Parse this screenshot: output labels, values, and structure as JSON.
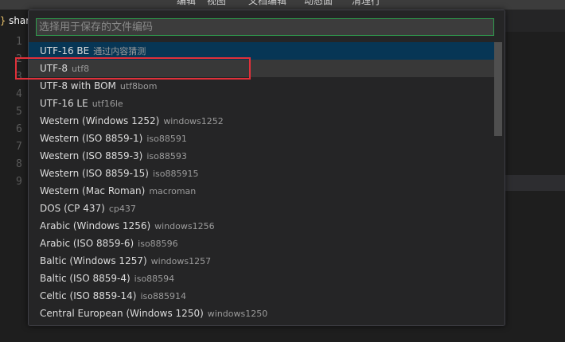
{
  "menubar": {
    "items": [
      "编辑",
      "视图",
      "文档编辑",
      "动态面",
      "清理行"
    ]
  },
  "tab": {
    "icon": "braces-file-icon",
    "label": "shar"
  },
  "gutter": {
    "lines": [
      "1",
      "2",
      "3",
      "4",
      "5",
      "6",
      "7",
      "8",
      "9"
    ]
  },
  "quickpick": {
    "placeholder": "选择用于保存的文件编码",
    "value": "",
    "items": [
      {
        "label": "UTF-16 BE",
        "desc": "通过内容猜测"
      },
      {
        "label": "UTF-8",
        "desc": "utf8"
      },
      {
        "label": "UTF-8 with BOM",
        "desc": "utf8bom"
      },
      {
        "label": "UTF-16 LE",
        "desc": "utf16le"
      },
      {
        "label": "Western (Windows 1252)",
        "desc": "windows1252"
      },
      {
        "label": "Western (ISO 8859-1)",
        "desc": "iso88591"
      },
      {
        "label": "Western (ISO 8859-3)",
        "desc": "iso88593"
      },
      {
        "label": "Western (ISO 8859-15)",
        "desc": "iso885915"
      },
      {
        "label": "Western (Mac Roman)",
        "desc": "macroman"
      },
      {
        "label": "DOS (CP 437)",
        "desc": "cp437"
      },
      {
        "label": "Arabic (Windows 1256)",
        "desc": "windows1256"
      },
      {
        "label": "Arabic (ISO 8859-6)",
        "desc": "iso88596"
      },
      {
        "label": "Baltic (Windows 1257)",
        "desc": "windows1257"
      },
      {
        "label": "Baltic (ISO 8859-4)",
        "desc": "iso88594"
      },
      {
        "label": "Celtic (ISO 8859-14)",
        "desc": "iso885914"
      },
      {
        "label": "Central European (Windows 1250)",
        "desc": "windows1250"
      }
    ]
  },
  "colors": {
    "active_item": "#073655",
    "hover_item": "#383838",
    "input_border": "#2f9e4e",
    "annotation_box": "#e0303a"
  }
}
